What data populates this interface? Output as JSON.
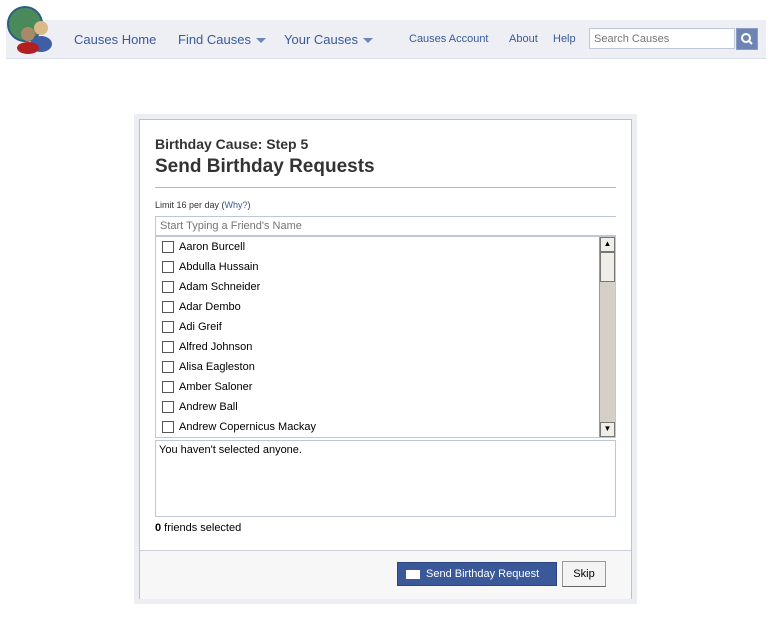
{
  "nav": {
    "home": "Causes Home",
    "find": "Find Causes",
    "yours": "Your Causes",
    "account": "Causes Account",
    "about": "About",
    "help": "Help",
    "search_placeholder": "Search Causes"
  },
  "main": {
    "step": "Birthday Cause: Step 5",
    "title": "Send Birthday Requests",
    "limit_prefix": "Limit 16 per day (",
    "why": "Why?",
    "limit_suffix": ")",
    "friend_placeholder": "Start Typing a Friend's Name",
    "friends": [
      "Aaron Burcell",
      "Abdulla Hussain",
      "Adam Schneider",
      "Adar Dembo",
      "Adi Greif",
      "Alfred Johnson",
      "Alisa Eagleston",
      "Amber Saloner",
      "Andrew Ball",
      "Andrew Copernicus Mackay"
    ],
    "selected_text": "You haven't selected anyone.",
    "count": "0",
    "count_suffix": " friends selected",
    "send": "Send Birthday Request",
    "skip": "Skip"
  }
}
